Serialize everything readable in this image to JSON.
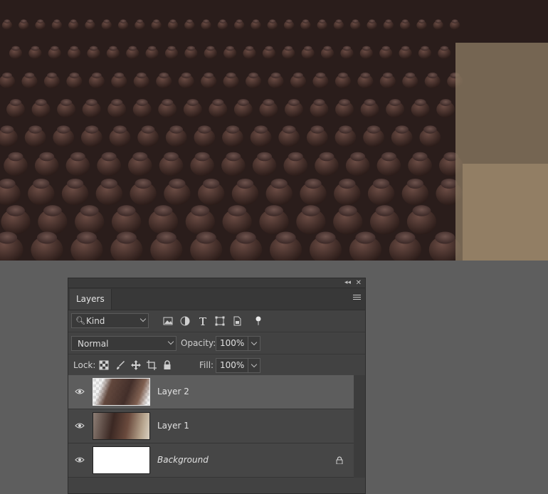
{
  "panel": {
    "tab_label": "Layers",
    "filter": {
      "kind_label": "Kind"
    },
    "blend_mode": "Normal",
    "opacity_label": "Opacity:",
    "opacity_value": "100%",
    "lock_label": "Lock:",
    "fill_label": "Fill:",
    "fill_value": "100%"
  },
  "layers": [
    {
      "name": "Layer 2",
      "selected": true,
      "thumbnail": "transparent-bottles"
    },
    {
      "name": "Layer 1",
      "selected": false,
      "thumbnail": "bottles-photo"
    },
    {
      "name": "Background",
      "selected": false,
      "thumbnail": "white",
      "locked": true
    }
  ],
  "colors": {
    "workspace": "#5e5e5e",
    "panel": "#424242",
    "selected_row": "#5d5d5d"
  }
}
